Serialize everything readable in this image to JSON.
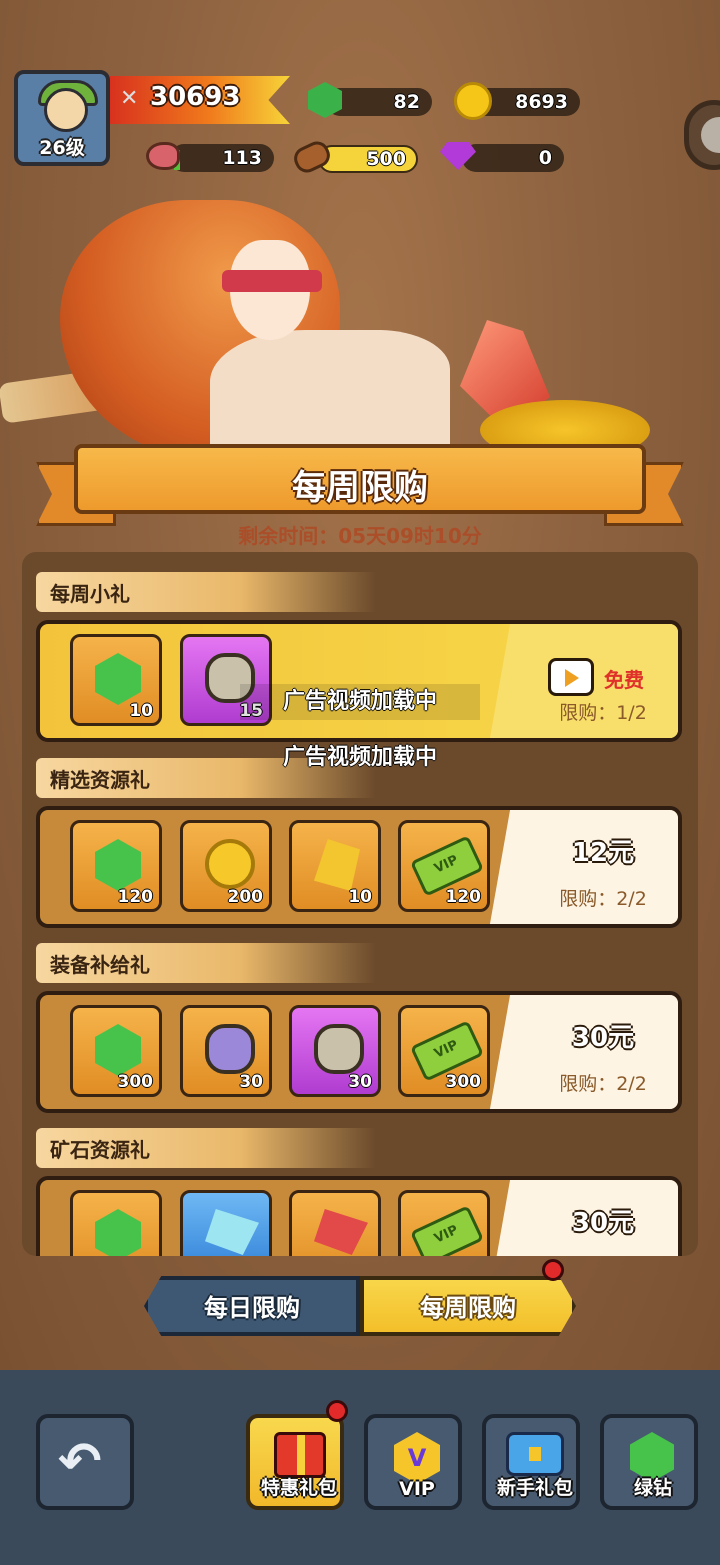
{
  "player": {
    "level": "26级",
    "power": "30693"
  },
  "resources": {
    "green_gems": "82",
    "coins": "8693",
    "meat": "113",
    "wood": "500",
    "diamonds": "0"
  },
  "header": {
    "title": "每周限购",
    "remaining_time": "剩余时间：05天09时10分"
  },
  "sections": [
    {
      "label": "每周小礼",
      "price": "免费",
      "limit": "限购：1/2",
      "items": [
        {
          "icon": "green-gem-icon",
          "qty": "10"
        },
        {
          "icon": "rune-stone-icon",
          "qty": "15"
        }
      ]
    },
    {
      "label": "精选资源礼",
      "price": "12元",
      "limit": "限购：2/2",
      "items": [
        {
          "icon": "green-gem-icon",
          "qty": "120"
        },
        {
          "icon": "gold-coin-icon",
          "qty": "200"
        },
        {
          "icon": "gold-ore-icon",
          "qty": "10"
        },
        {
          "icon": "vip-ticket-icon",
          "qty": "120"
        }
      ]
    },
    {
      "label": "装备补给礼",
      "price": "30元",
      "limit": "限购：2/2",
      "items": [
        {
          "icon": "green-gem-icon",
          "qty": "300"
        },
        {
          "icon": "purple-rune-icon",
          "qty": "30"
        },
        {
          "icon": "rune-stone-icon",
          "qty": "30"
        },
        {
          "icon": "vip-ticket-icon",
          "qty": "300"
        }
      ]
    },
    {
      "label": "矿石资源礼",
      "price": "30元",
      "items": [
        {
          "icon": "green-gem-icon"
        },
        {
          "icon": "blue-crystal-icon"
        },
        {
          "icon": "red-crystal-icon"
        },
        {
          "icon": "vip-ticket-icon"
        }
      ]
    }
  ],
  "ad_overlay": {
    "text_1": "广告视频加载中",
    "text_2": "广告视频加载中"
  },
  "tabs": {
    "daily": "每日限购",
    "weekly": "每周限购",
    "active": "weekly"
  },
  "bottom_nav": [
    {
      "label": "",
      "icon": "back-icon"
    },
    {
      "label": "特惠礼包",
      "icon": "gift-icon"
    },
    {
      "label": "VIP",
      "icon": "vip-icon"
    },
    {
      "label": "新手礼包",
      "icon": "chest-icon"
    },
    {
      "label": "绿钻",
      "icon": "green-gem-icon"
    }
  ],
  "vip_ticket_text": "VIP",
  "colors": {
    "accent": "#f3bf2a",
    "panel": "#6b4a2c",
    "red_dot": "#e32a2a"
  }
}
